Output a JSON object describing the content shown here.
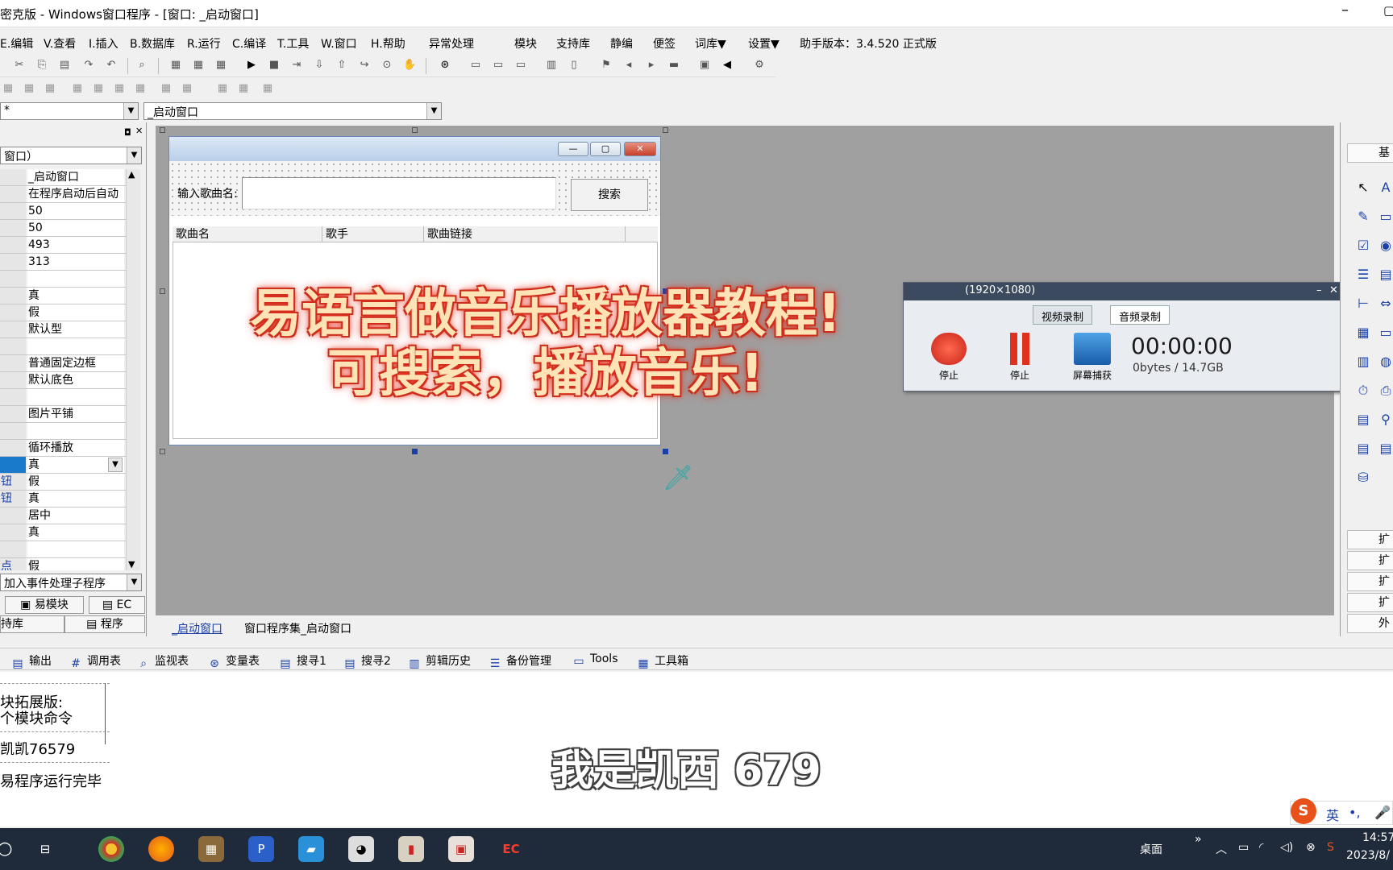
{
  "window": {
    "title": "密克版 - Windows窗口程序 - [窗口: _启动窗口]",
    "min_glyph": "–",
    "max_glyph": "▢"
  },
  "menu": [
    "E.编辑",
    "V.查看",
    "I.插入",
    "B.数据库",
    "R.运行",
    "C.编译",
    "T.工具",
    "W.窗口",
    "H.帮助",
    "异常处理",
    "模块",
    "支持库",
    "静编",
    "便签",
    "词库▼",
    "设置▼",
    "助手版本：3.4.520 正式版"
  ],
  "combos": {
    "left": "*",
    "right": "_启动窗口",
    "component": "窗口）"
  },
  "properties": [
    {
      "k": "",
      "v": "_启动窗口"
    },
    {
      "k": "",
      "v": "在程序启动后自动"
    },
    {
      "k": "",
      "v": "50"
    },
    {
      "k": "",
      "v": "50"
    },
    {
      "k": "",
      "v": "493"
    },
    {
      "k": "",
      "v": "313"
    },
    {
      "k": "",
      "v": ""
    },
    {
      "k": "",
      "v": "真"
    },
    {
      "k": "",
      "v": "假"
    },
    {
      "k": "",
      "v": "默认型"
    },
    {
      "k": "",
      "v": ""
    },
    {
      "k": "",
      "v": "普通固定边框"
    },
    {
      "k": "",
      "v": "默认底色"
    },
    {
      "k": "",
      "v": ""
    },
    {
      "k": "",
      "v": "图片平铺"
    },
    {
      "k": "",
      "v": ""
    },
    {
      "k": "",
      "v": "循环播放"
    },
    {
      "k": "",
      "v": "真"
    },
    {
      "k": "钮",
      "v": "假"
    },
    {
      "k": "钮",
      "v": "真"
    },
    {
      "k": "",
      "v": "居中"
    },
    {
      "k": "",
      "v": "真"
    },
    {
      "k": "",
      "v": ""
    },
    {
      "k": "点",
      "v": "假"
    }
  ],
  "event_combo": "加入事件处理子程序",
  "left_buttons": {
    "module": "易模块",
    "ec": "EC",
    "lib": "持库",
    "program": "程序"
  },
  "design": {
    "search_label": "输入歌曲名:",
    "search_button": "搜索",
    "columns": [
      "歌曲名",
      "歌手",
      "歌曲链接"
    ],
    "btn_min": "—",
    "btn_max": "▢",
    "btn_close": "✕"
  },
  "overlay": {
    "line1": "易语言做音乐播放器教程!",
    "line2": "可搜索，播放音乐!"
  },
  "recorder": {
    "header": "(1920×1080)",
    "tab_video": "视频录制",
    "tab_audio": "音频录制",
    "btn_stop1": "停止",
    "btn_stop2": "停止",
    "btn_capture": "屏幕捕获",
    "timer": "00:00:00",
    "size": "0bytes / 14.7GB",
    "close": "✕",
    "minimize": "–"
  },
  "editor_tabs": [
    "_启动窗口",
    "窗口程序集_启动窗口"
  ],
  "right_panel": {
    "top": "基",
    "expanders": [
      "扩",
      "扩",
      "扩",
      "扩",
      "外"
    ]
  },
  "output_tabs": [
    "输出",
    "调用表",
    "监视表",
    "变量表",
    "搜寻1",
    "搜寻2",
    "剪辑历史",
    "备份管理",
    "Tools",
    "工具箱"
  ],
  "output_lines": [
    "块拓展版:",
    "个模块命令",
    "凯凯76579",
    "易程序运行完毕"
  ],
  "caption": "我是凯西 679",
  "ime": {
    "lang": "英",
    "punct": "•,"
  },
  "taskbar": {
    "desktop": "桌面",
    "time": "14:57",
    "date": "2023/8/"
  }
}
